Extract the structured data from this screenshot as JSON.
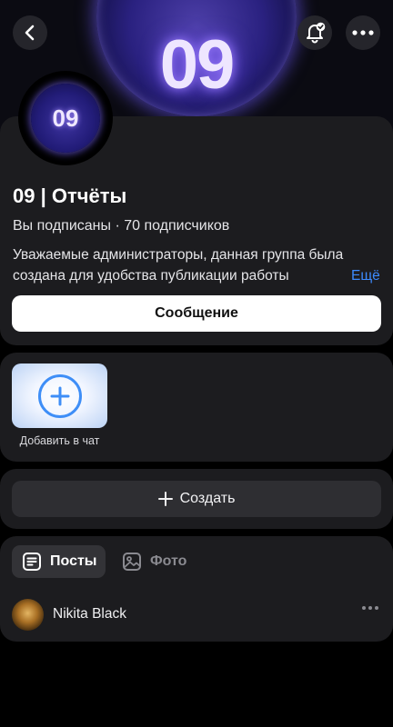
{
  "group": {
    "cover_number": "09",
    "avatar_text": "09",
    "title": "09 | Отчёты",
    "subscription": "Вы подписаны · 70 подписчиков",
    "description": "Уважаемые администраторы, данная группа была создана для удобства публикации работы администрации",
    "more_link": "Ещё"
  },
  "buttons": {
    "message": "Сообщение",
    "add_to_chat": "Добавить в чат",
    "create": "Создать"
  },
  "tabs": [
    {
      "label": "Посты",
      "icon": "posts-icon",
      "active": true
    },
    {
      "label": "Фото",
      "icon": "photo-icon",
      "active": false
    }
  ],
  "post": {
    "author": "Nikita Black"
  },
  "colors": {
    "accent": "#3d8bff",
    "card": "#1c1c1f",
    "background": "#000000"
  },
  "icons": [
    "back-icon",
    "notifications-bell-icon",
    "more-icon",
    "plus-icon"
  ]
}
